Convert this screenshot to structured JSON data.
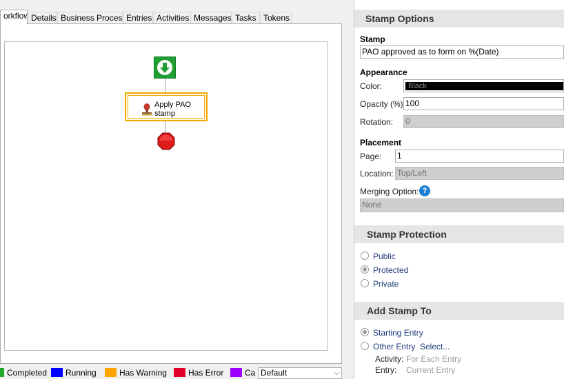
{
  "tabs": [
    {
      "label": "orkflow",
      "active": true
    },
    {
      "label": "Details"
    },
    {
      "label": "Business Process"
    },
    {
      "label": "Entries"
    },
    {
      "label": "Activities"
    },
    {
      "label": "Messages"
    },
    {
      "label": "Tasks"
    },
    {
      "label": "Tokens"
    }
  ],
  "workflow": {
    "activity_label": "Apply PAO stamp"
  },
  "legend": {
    "items": [
      {
        "label": "Completed",
        "color": "#1faa2c"
      },
      {
        "label": "Running",
        "color": "#0000ff"
      },
      {
        "label": "Has Warning",
        "color": "#ffa500"
      },
      {
        "label": "Has Error",
        "color": "#e0002a"
      },
      {
        "label": "Ca",
        "color": "#9b00ff"
      }
    ],
    "view_selected": "Default"
  },
  "stamp_options": {
    "header": "Stamp Options",
    "stamp_label": "Stamp",
    "stamp_value": "PAO approved as to form on %(Date)",
    "appearance_label": "Appearance",
    "color_label": "Color:",
    "color_value": "Black",
    "opacity_label": "Opacity (%):",
    "opacity_value": "100",
    "rotation_label": "Rotation:",
    "rotation_value": "0",
    "placement_label": "Placement",
    "page_label": "Page:",
    "page_value": "1",
    "location_label": "Location:",
    "location_value": "Top/Left",
    "merging_label": "Merging Option:",
    "merging_value": "None"
  },
  "stamp_protection": {
    "header": "Stamp Protection",
    "options": [
      {
        "label": "Public",
        "checked": false
      },
      {
        "label": "Protected",
        "checked": true
      },
      {
        "label": "Private",
        "checked": false
      }
    ]
  },
  "add_stamp_to": {
    "header": "Add Stamp To",
    "starting_entry": "Starting Entry",
    "other_entry": "Other Entry",
    "select_link": "Select...",
    "activity_label": "Activity:",
    "activity_value": "For Each Entry",
    "entry_label": "Entry:",
    "entry_value": "Current Entry"
  }
}
